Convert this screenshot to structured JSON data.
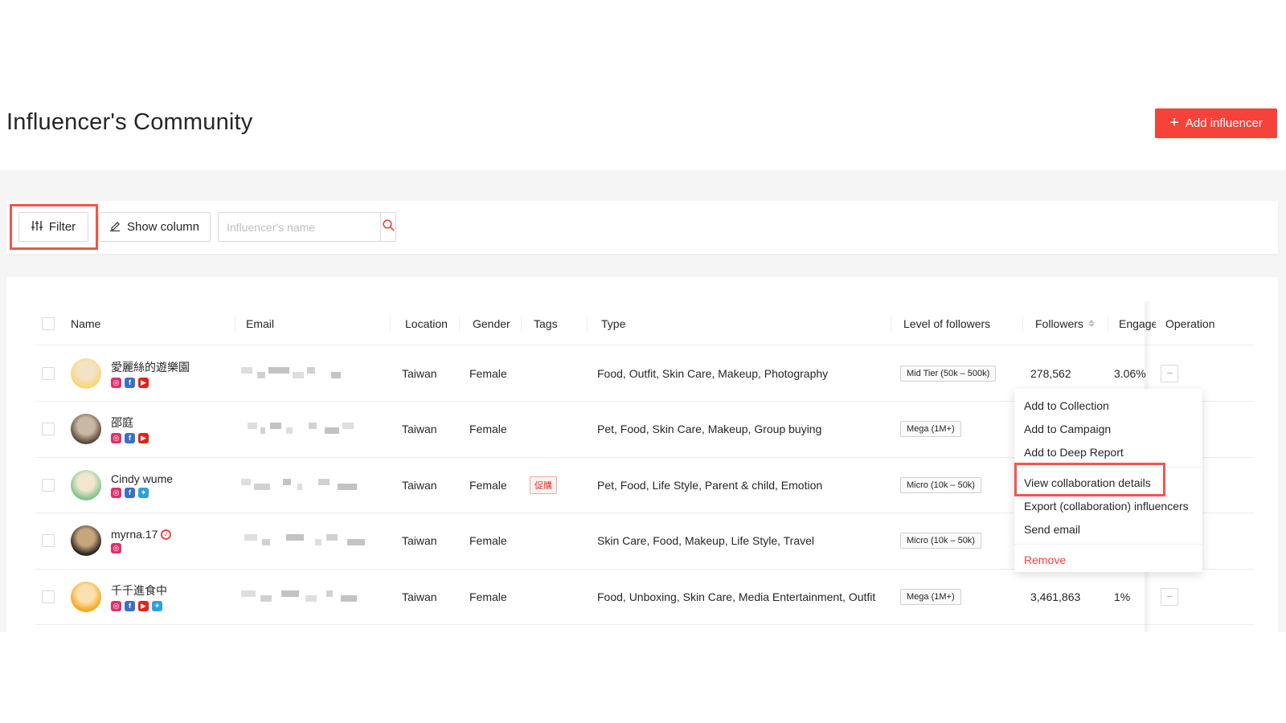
{
  "header": {
    "title": "Influencer's Community",
    "add_button_label": "Add influencer",
    "add_button_icon": "plus-icon",
    "accent_color": "#f5423a"
  },
  "toolbar": {
    "filter_label": "Filter",
    "filter_icon": "sliders-icon",
    "show_column_label": "Show column",
    "show_column_icon": "pencil-icon",
    "search_placeholder": "Influencer's name",
    "search_value": "",
    "search_icon": "search-icon"
  },
  "table": {
    "columns": {
      "name": "Name",
      "email": "Email",
      "location": "Location",
      "gender": "Gender",
      "tags": "Tags",
      "type": "Type",
      "level": "Level of followers",
      "followers": "Followers",
      "engagement": "Engage",
      "operation": "Operation"
    },
    "rows": [
      {
        "name": "愛麗絲的遊樂園",
        "verified": false,
        "socials": [
          "instagram",
          "facebook",
          "youtube"
        ],
        "email": "(blurred)",
        "location": "Taiwan",
        "gender": "Female",
        "tag": "",
        "type": "Food, Outfit, Skin Care, Makeup, Photography",
        "level": "Mid Tier (50k – 500k)",
        "followers": "278,562",
        "engagement": "3.06%",
        "operation": "···"
      },
      {
        "name": "邵庭",
        "verified": false,
        "socials": [
          "instagram",
          "facebook",
          "youtube"
        ],
        "email": "(blurred)",
        "location": "Taiwan",
        "gender": "Female",
        "tag": "",
        "type": "Pet, Food, Skin Care, Makeup, Group buying",
        "level": "Mega (1M+)",
        "followers": "",
        "engagement": "",
        "operation": ""
      },
      {
        "name": "Cindy wume",
        "verified": false,
        "socials": [
          "instagram",
          "facebook",
          "twitter"
        ],
        "email": "(blurred)",
        "location": "Taiwan",
        "gender": "Female",
        "tag": "促購",
        "type": "Pet, Food, Life Style, Parent & child, Emotion",
        "level": "Micro (10k – 50k)",
        "followers": "",
        "engagement": "",
        "operation": ""
      },
      {
        "name": "myrna.17",
        "verified": true,
        "socials": [
          "instagram"
        ],
        "email": "(blurred)",
        "location": "Taiwan",
        "gender": "Female",
        "tag": "",
        "type": "Skin Care, Food, Makeup, Life Style, Travel",
        "level": "Micro (10k – 50k)",
        "followers": "",
        "engagement": "",
        "operation": ""
      },
      {
        "name": "千千進食中",
        "verified": false,
        "socials": [
          "instagram",
          "facebook",
          "youtube",
          "twitter"
        ],
        "email": "(blurred)",
        "location": "Taiwan",
        "gender": "Female",
        "tag": "",
        "type": "Food, Unboxing, Skin Care, Media Entertainment, Outfit",
        "level": "Mega (1M+)",
        "followers": "3,461,863",
        "engagement": "1%",
        "operation": "···"
      }
    ]
  },
  "operation_menu": {
    "items": [
      "Add to Collection",
      "Add to Campaign",
      "Add to Deep Report",
      "View collaboration details",
      "Export (collaboration) influencers",
      "Send email",
      "Remove"
    ],
    "highlighted": "View collaboration details",
    "danger_color": "#f5423a"
  }
}
